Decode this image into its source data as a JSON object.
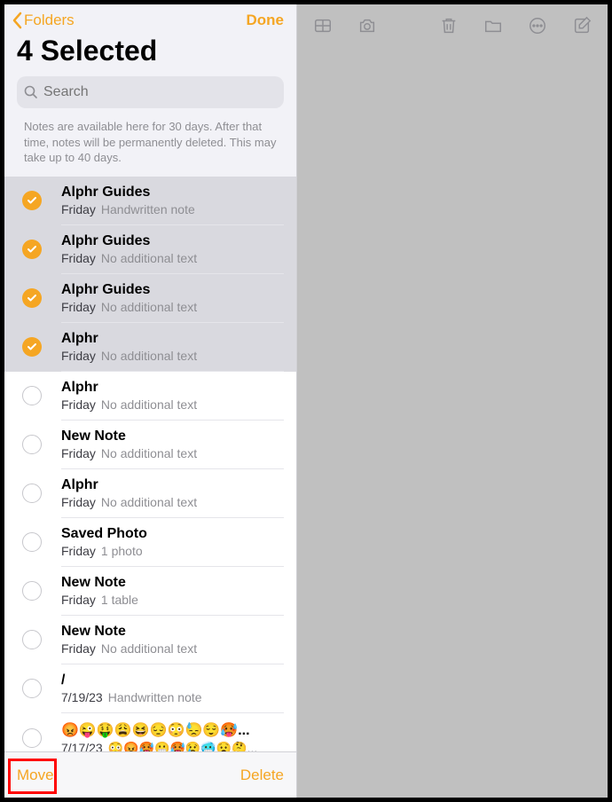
{
  "header": {
    "back_label": "Folders",
    "done_label": "Done",
    "title": "4 Selected"
  },
  "search": {
    "placeholder": "Search"
  },
  "info_text": "Notes are available here for 30 days. After that time, notes will be permanently deleted. This may take up to 40 days.",
  "notes": [
    {
      "selected": true,
      "title": "Alphr Guides",
      "date": "Friday",
      "preview": "Handwritten note"
    },
    {
      "selected": true,
      "title": "Alphr Guides",
      "date": "Friday",
      "preview": "No additional text"
    },
    {
      "selected": true,
      "title": "Alphr Guides",
      "date": "Friday",
      "preview": "No additional text"
    },
    {
      "selected": true,
      "title": "Alphr",
      "date": "Friday",
      "preview": "No additional text"
    },
    {
      "selected": false,
      "title": "Alphr",
      "date": "Friday",
      "preview": "No additional text"
    },
    {
      "selected": false,
      "title": "New Note",
      "date": "Friday",
      "preview": "No additional text"
    },
    {
      "selected": false,
      "title": "Alphr",
      "date": "Friday",
      "preview": "No additional text"
    },
    {
      "selected": false,
      "title": "Saved Photo",
      "date": "Friday",
      "preview": "1 photo"
    },
    {
      "selected": false,
      "title": "New Note",
      "date": "Friday",
      "preview": "1 table"
    },
    {
      "selected": false,
      "title": "New Note",
      "date": "Friday",
      "preview": "No additional text"
    },
    {
      "selected": false,
      "title": "/",
      "date": "7/19/23",
      "preview": "Handwritten note"
    },
    {
      "selected": false,
      "title": "😡😜🤑😩😆😔😳😓😌🥵...",
      "date": "7/17/23",
      "preview": "😳😡🥵😬🥵😢🥶😧🤔..."
    }
  ],
  "bottom": {
    "move_label": "Move",
    "delete_label": "Delete"
  },
  "colors": {
    "accent": "#f5a623",
    "highlight": "#ff0000"
  }
}
